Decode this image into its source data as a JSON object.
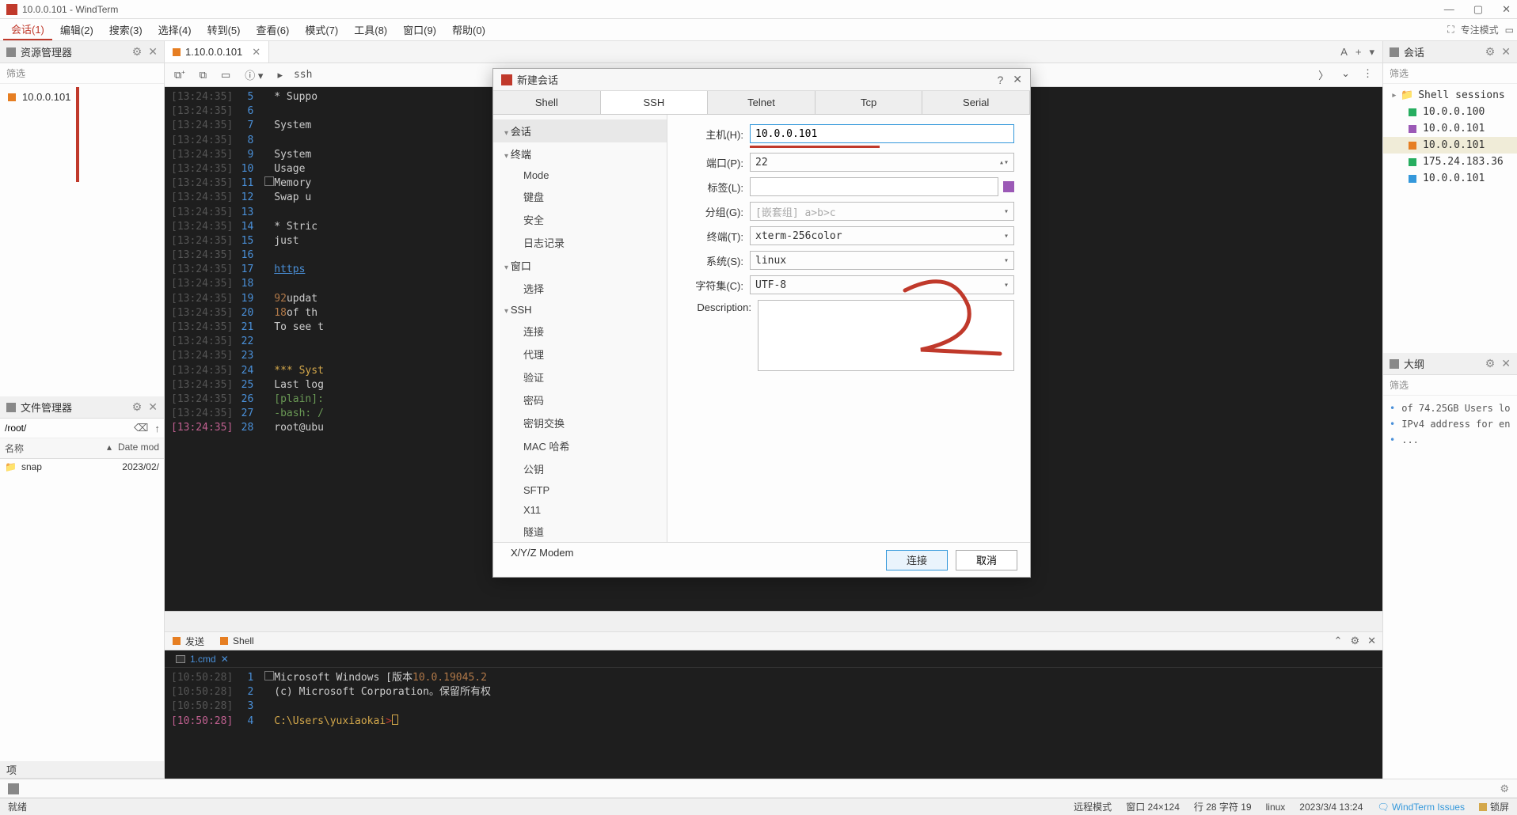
{
  "titlebar": {
    "title": "10.0.0.101 - WindTerm"
  },
  "menubar": {
    "items": [
      "会话(1)",
      "编辑(2)",
      "搜索(3)",
      "选择(4)",
      "转到(5)",
      "查看(6)",
      "模式(7)",
      "工具(8)",
      "窗口(9)",
      "帮助(0)"
    ],
    "focus": "专注模式"
  },
  "left": {
    "resource_header": "资源管理器",
    "filter": "筛选",
    "tree": [
      {
        "label": "10.0.0.101",
        "color": "sq-orange"
      }
    ],
    "fm_header": "文件管理器",
    "fm_path": "/root/",
    "fm_cols": {
      "name": "名称",
      "date": "Date mod"
    },
    "fm_rows": [
      {
        "name": "snap",
        "date": "2023/02/"
      }
    ],
    "items_label": "项"
  },
  "center": {
    "tab": {
      "label": "1.10.0.0.101"
    },
    "toolbar": {
      "addr": "ssh"
    },
    "lines": [
      {
        "ts": "[13:24:35]",
        "ln": "5",
        "txt": "* Suppo"
      },
      {
        "ts": "[13:24:35]",
        "ln": "6",
        "txt": ""
      },
      {
        "ts": "[13:24:35]",
        "ln": "7",
        "txt": "System"
      },
      {
        "ts": "[13:24:35]",
        "ln": "8",
        "txt": ""
      },
      {
        "ts": "[13:24:35]",
        "ln": "9",
        "txt": "System"
      },
      {
        "ts": "[13:24:35]",
        "ln": "10",
        "txt": "Usage"
      },
      {
        "ts": "[13:24:35]",
        "ln": "11",
        "txt": "Memory",
        "box": true
      },
      {
        "ts": "[13:24:35]",
        "ln": "12",
        "txt": "Swap u"
      },
      {
        "ts": "[13:24:35]",
        "ln": "13",
        "txt": ""
      },
      {
        "ts": "[13:24:35]",
        "ln": "14",
        "txt": "* Stric"
      },
      {
        "ts": "[13:24:35]",
        "ln": "15",
        "txt": "just"
      },
      {
        "ts": "[13:24:35]",
        "ln": "16",
        "txt": ""
      },
      {
        "ts": "[13:24:35]",
        "ln": "17",
        "txt": "https",
        "link": true
      },
      {
        "ts": "[13:24:35]",
        "ln": "18",
        "txt": ""
      },
      {
        "ts": "[13:24:35]",
        "ln": "19",
        "pre": "92",
        "txt": " updat"
      },
      {
        "ts": "[13:24:35]",
        "ln": "20",
        "pre": "18",
        "txt": " of th"
      },
      {
        "ts": "[13:24:35]",
        "ln": "21",
        "txt": "To see t"
      },
      {
        "ts": "[13:24:35]",
        "ln": "22",
        "txt": ""
      },
      {
        "ts": "[13:24:35]",
        "ln": "23",
        "txt": ""
      },
      {
        "ts": "[13:24:35]",
        "ln": "24",
        "txt": "*** Syst",
        "kw": true
      },
      {
        "ts": "[13:24:35]",
        "ln": "25",
        "txt": "Last log",
        "lg": true
      },
      {
        "ts": "[13:24:35]",
        "ln": "26",
        "txt": "[plain]:",
        "pl": true
      },
      {
        "ts": "[13:24:35]",
        "ln": "27",
        "txt": "-bash: /",
        "gr": true
      },
      {
        "ts": "[13:24:35]",
        "ln": "28",
        "txt": "root@ubu",
        "pink": true
      }
    ]
  },
  "bottom": {
    "send": "发送",
    "shell": "Shell",
    "cmd_tab": "1.cmd",
    "lines": [
      {
        "ts": "[10:50:28]",
        "ln": "1",
        "txt": "Microsoft Windows [版本 ",
        "ver": "10.0.19045.2",
        "box": true
      },
      {
        "ts": "[10:50:28]",
        "ln": "2",
        "txt": "(c) Microsoft Corporation。保留所有权"
      },
      {
        "ts": "[10:50:28]",
        "ln": "3",
        "txt": ""
      },
      {
        "ts": "[10:50:28]",
        "ln": "4",
        "txt": "C:\\Users\\yuxiaokai",
        "prompt": true,
        "pink": true
      }
    ]
  },
  "right": {
    "session_header": "会话",
    "filter": "筛选",
    "shell_folder": "Shell sessions",
    "sessions": [
      {
        "label": "10.0.0.100",
        "color": "sq-green"
      },
      {
        "label": "10.0.0.101",
        "color": "sq-purple"
      },
      {
        "label": "10.0.0.101",
        "color": "sq-orange",
        "hl": true
      },
      {
        "label": "175.24.183.36",
        "color": "sq-green"
      },
      {
        "label": "10.0.0.101",
        "color": "sq-blue"
      }
    ],
    "outline_header": "大纲",
    "outline": [
      "of 74.25GB Users lo",
      "IPv4 address for en",
      "..."
    ]
  },
  "dialog": {
    "title": "新建会话",
    "tabs": [
      "Shell",
      "SSH",
      "Telnet",
      "Tcp",
      "Serial"
    ],
    "sidebar": {
      "session": "会话",
      "terminal": "终端",
      "mode": "Mode",
      "keyboard": "键盘",
      "security": "安全",
      "logging": "日志记录",
      "window": "窗口",
      "select": "选择",
      "ssh": "SSH",
      "conn": "连接",
      "proxy": "代理",
      "auth": "验证",
      "password": "密码",
      "key": "密钥交换",
      "mac": "MAC 哈希",
      "pubkey": "公钥",
      "sftp": "SFTP",
      "x11": "X11",
      "tunnel": "隧道",
      "modem": "X/Y/Z Modem"
    },
    "form": {
      "host_label": "主机(H):",
      "host": "10.0.0.101",
      "port_label": "端口(P):",
      "port": "22",
      "tag_label": "标签(L):",
      "tag": "",
      "group_label": "分组(G):",
      "group_placeholder": "[嵌套组] a>b>c",
      "term_label": "终端(T):",
      "term": "xterm-256color",
      "system_label": "系统(S):",
      "system": "linux",
      "charset_label": "字符集(C):",
      "charset": "UTF-8",
      "desc_label": "Description:"
    },
    "buttons": {
      "connect": "连接",
      "cancel": "取消"
    }
  },
  "status": {
    "ready": "就绪",
    "remote": "远程模式",
    "window": "窗口 24×124",
    "pos": "行 28 字符 19",
    "os": "linux",
    "date": "2023/3/4 13:24",
    "issues": "WindTerm Issues",
    "lock": "锁屏"
  }
}
